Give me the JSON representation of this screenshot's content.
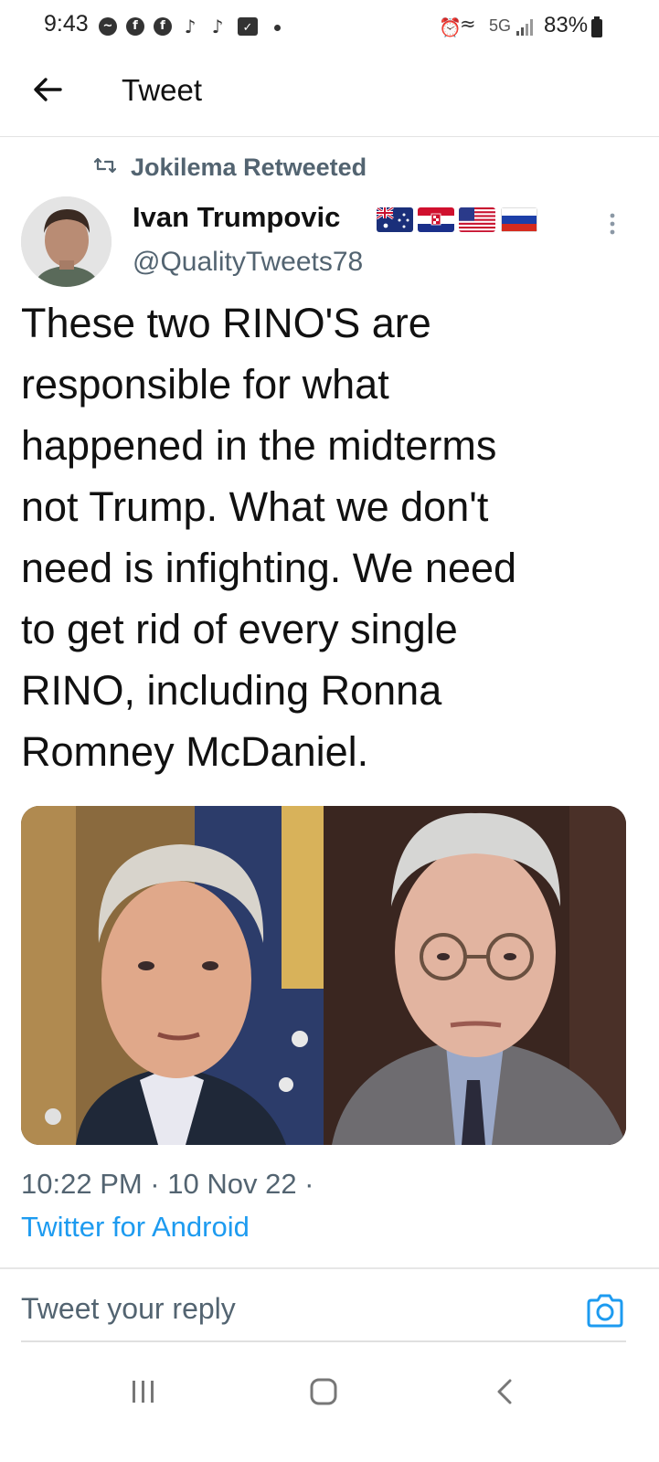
{
  "status_bar": {
    "time": "9:43",
    "network": "5G",
    "battery": "83%"
  },
  "header": {
    "title": "Tweet"
  },
  "tweet": {
    "retweeted_by": "Jokilema Retweeted",
    "author_name": "Ivan Trumpovic",
    "author_handle": "@QualityTweets78",
    "flags": [
      "australia-flag",
      "croatia-flag",
      "usa-flag",
      "russia-flag"
    ],
    "text": "These two RINO'S are\nresponsible for what\nhappened in the midterms\nnot Trump. What we don't\nneed is infighting. We need\nto get rid of every single\nRINO, including Ronna\nRomney McDaniel.",
    "timestamp": "10:22 PM · 10 Nov 22 ·",
    "client": "Twitter for Android"
  },
  "reply": {
    "placeholder": "Tweet your reply"
  },
  "colors": {
    "accent": "#1d9bf0",
    "secondary_text": "#536471"
  }
}
